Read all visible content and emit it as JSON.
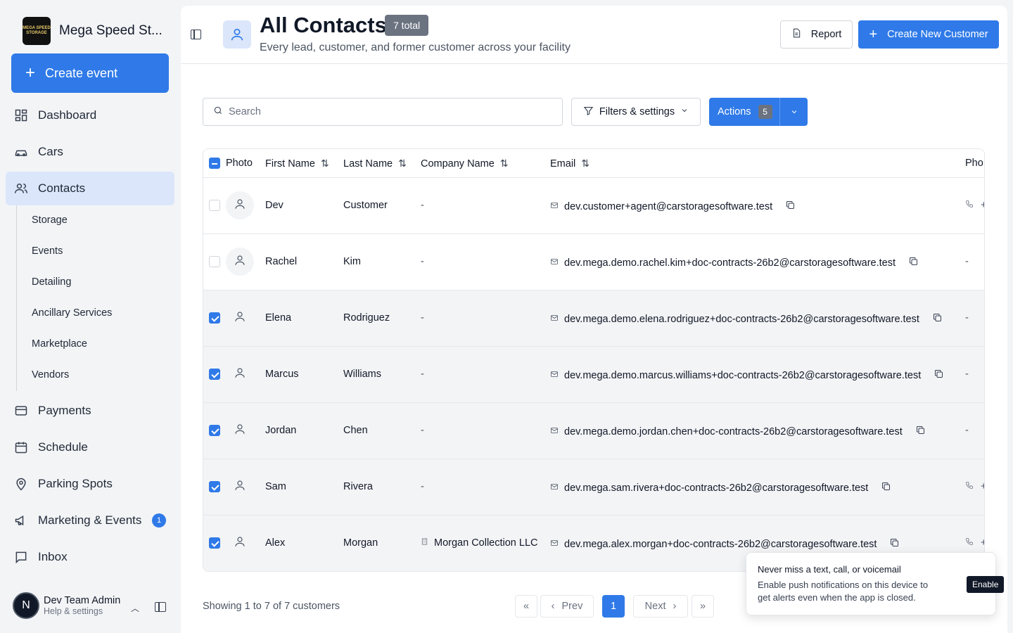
{
  "brand": {
    "name": "Mega Speed St...",
    "logo_text": "MEGA SPEED STORAGE"
  },
  "sidebar": {
    "create_label": "Create event",
    "items": [
      {
        "label": "Dashboard"
      },
      {
        "label": "Cars"
      },
      {
        "label": "Contacts"
      },
      {
        "label": "Payments"
      },
      {
        "label": "Schedule"
      },
      {
        "label": "Parking Spots"
      },
      {
        "label": "Marketing & Events",
        "badge": "1"
      },
      {
        "label": "Inbox"
      }
    ],
    "subitems": [
      "Storage",
      "Events",
      "Detailing",
      "Ancillary Services",
      "Marketplace",
      "Vendors"
    ],
    "user": {
      "initial": "N",
      "name": "Dev Team Admin",
      "sub": "Help & settings"
    }
  },
  "header": {
    "title": "All Contacts",
    "total_badge": "7 total",
    "subtitle": "Every lead, customer, and former customer across your facility",
    "report_label": "Report",
    "create_label": "Create New Customer"
  },
  "toolbar": {
    "search_placeholder": "Search",
    "filters_label": "Filters & settings",
    "actions_label": "Actions",
    "actions_count": "5"
  },
  "table": {
    "columns": [
      "Photo",
      "First Name",
      "Last Name",
      "Company Name",
      "Email",
      "Pho"
    ],
    "rows": [
      {
        "first": "Dev",
        "last": "Customer",
        "company": "-",
        "email": "dev.customer+agent@carstoragesoftware.test",
        "phone": "+",
        "selected": false
      },
      {
        "first": "Rachel",
        "last": "Kim",
        "company": "-",
        "email": "dev.mega.demo.rachel.kim+doc-contracts-26b2@carstoragesoftware.test",
        "phone": "-",
        "selected": false
      },
      {
        "first": "Elena",
        "last": "Rodriguez",
        "company": "-",
        "email": "dev.mega.demo.elena.rodriguez+doc-contracts-26b2@carstoragesoftware.test",
        "phone": "-",
        "selected": true
      },
      {
        "first": "Marcus",
        "last": "Williams",
        "company": "-",
        "email": "dev.mega.demo.marcus.williams+doc-contracts-26b2@carstoragesoftware.test",
        "phone": "-",
        "selected": true
      },
      {
        "first": "Jordan",
        "last": "Chen",
        "company": "-",
        "email": "dev.mega.demo.jordan.chen+doc-contracts-26b2@carstoragesoftware.test",
        "phone": "-",
        "selected": true
      },
      {
        "first": "Sam",
        "last": "Rivera",
        "company": "-",
        "email": "dev.mega.sam.rivera+doc-contracts-26b2@carstoragesoftware.test",
        "phone": "+",
        "selected": true
      },
      {
        "first": "Alex",
        "last": "Morgan",
        "company": "Morgan Collection LLC",
        "email": "dev.mega.alex.morgan+doc-contracts-26b2@carstoragesoftware.test",
        "phone": "+",
        "selected": true
      }
    ]
  },
  "footer": {
    "showing": "Showing 1 to 7 of 7 customers",
    "first": "«",
    "prev": "Prev",
    "page": "1",
    "next": "Next",
    "last": "»"
  },
  "toast": {
    "title": "Never miss a text, call, or voicemail",
    "body": "Enable push notifications on this device to get alerts even when the app is closed.",
    "button": "Enable"
  },
  "colors": {
    "accent": "#2f7ae8",
    "active_nav": "#dbe6fb"
  }
}
